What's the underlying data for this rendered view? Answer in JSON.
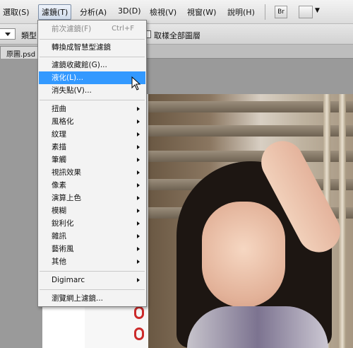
{
  "menubar": {
    "items": [
      "選取(S)",
      "濾鏡(T)",
      "分析(A)",
      "3D(D)",
      "檢視(V)",
      "視窗(W)",
      "說明(H)"
    ],
    "tool1": "Br",
    "tool2": "▼"
  },
  "options": {
    "type_label": "類型",
    "sample_all_layers": "取樣全部圖層"
  },
  "tabs": {
    "document": "原圖.psd"
  },
  "filter_menu": {
    "last_filter": "前次濾鏡(F)",
    "last_filter_shortcut": "Ctrl+F",
    "convert_smart": "轉換成智慧型濾鏡",
    "gallery": "濾鏡收藏館(G)...",
    "liquify": "液化(L)...",
    "vanishing_point": "消失點(V)...",
    "submenus": [
      "扭曲",
      "風格化",
      "紋理",
      "素描",
      "筆觸",
      "視訊效果",
      "像素",
      "演算上色",
      "模糊",
      "銳利化",
      "雜訊",
      "藝術風",
      "其他"
    ],
    "digimarc": "Digimarc",
    "browse_online": "瀏覽網上濾鏡..."
  },
  "colors": {
    "highlight": "#3399ff",
    "menu_bg": "#f3f3f3"
  }
}
